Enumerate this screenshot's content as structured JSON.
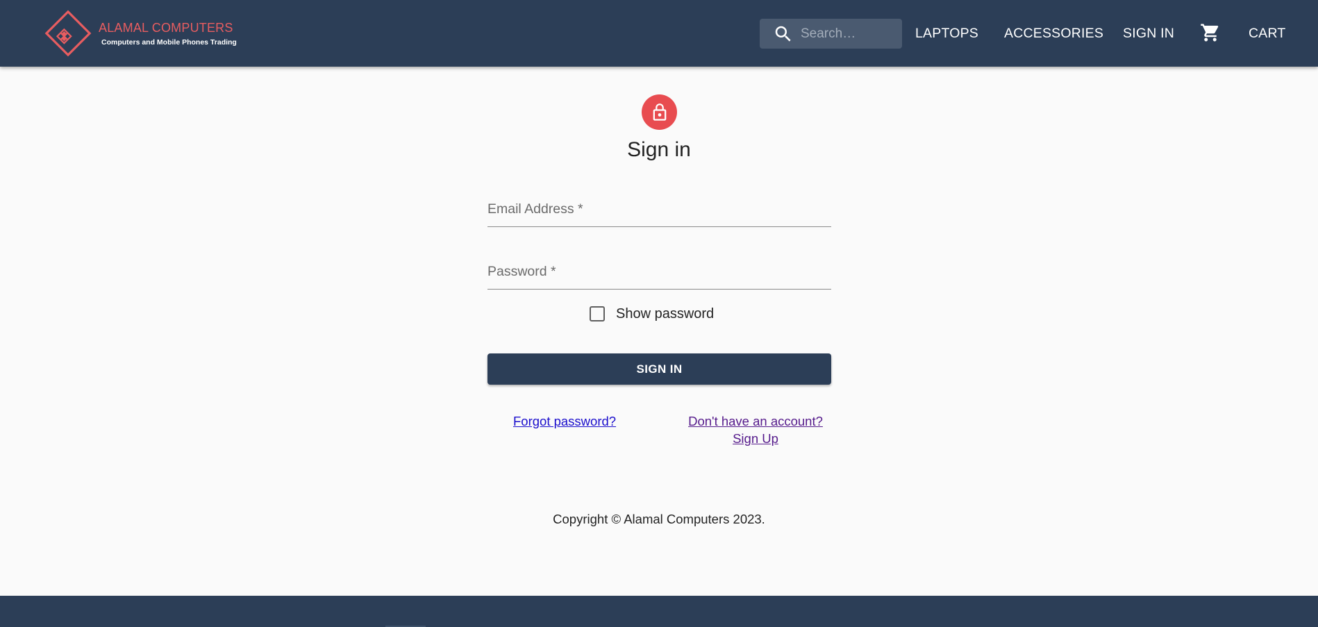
{
  "brand": {
    "name": "ALAMAL COMPUTERS",
    "tagline": "Computers and Mobile Phones Trading"
  },
  "header": {
    "search": {
      "placeholder": "Search…",
      "value": ""
    },
    "nav": {
      "laptops": "LAPTOPS",
      "accessories": "ACCESSORIES",
      "sign_in": "SIGN IN",
      "cart": "CART"
    }
  },
  "form": {
    "title": "Sign in",
    "email_label": "Email Address *",
    "email_value": "",
    "password_label": "Password *",
    "password_value": "",
    "show_password_label": "Show password",
    "show_password_checked": false,
    "submit_label": "SIGN IN",
    "forgot_password_link": "Forgot password?",
    "signup_link_line1": "Don't have an account?",
    "signup_link_line2": "Sign Up"
  },
  "footer": {
    "copyright": "Copyright © Alamal Computers 2023."
  },
  "colors": {
    "header_bg": "#2c3e57",
    "brand_accent": "#e85d60",
    "avatar_bg": "#e84c50",
    "page_bg": "#fafafa",
    "link": "#1a0dcc",
    "visited_link": "#551a8b"
  },
  "icons": {
    "logo": "diamond-logo-icon",
    "search": "search-icon",
    "cart": "cart-icon",
    "lock": "lock-icon",
    "checkbox": "checkbox-unchecked-icon"
  }
}
